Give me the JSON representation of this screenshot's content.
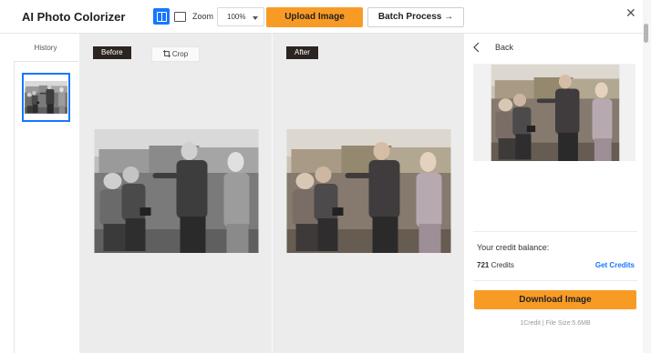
{
  "app": {
    "title": "AI Photo Colorizer"
  },
  "toolbar": {
    "zoom_label": "Zoom",
    "zoom_value": "100%",
    "upload_label": "Upload Image",
    "batch_label": "Batch Process →",
    "close_glyph": "✕"
  },
  "history": {
    "title": "History"
  },
  "compare": {
    "before_label": "Before",
    "after_label": "After",
    "crop_label": "Crop"
  },
  "panel": {
    "back_label": "Back",
    "balance_label": "Your credit balance:",
    "credits_value": "721",
    "credits_unit": " Credits",
    "get_credits_label": "Get Credits",
    "download_label": "Download Image",
    "file_info": "1Credit | File Size:5.6MB"
  },
  "colors": {
    "accent": "#1677ff",
    "primary_button": "#f89b25",
    "tag_bg": "#2b2421"
  },
  "icons": [
    "split-view-icon",
    "single-view-icon",
    "chevron-down-icon",
    "close-icon",
    "crop-icon",
    "chevron-left-icon"
  ]
}
